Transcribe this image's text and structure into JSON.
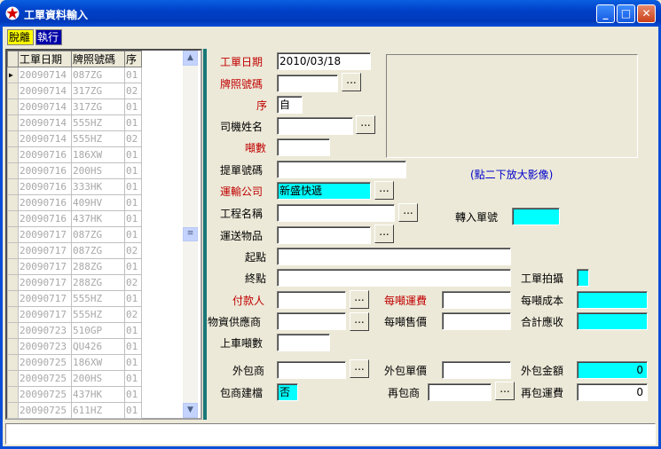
{
  "window": {
    "title": "工單資料輸入"
  },
  "toolbar": {
    "leave_label": "脫離",
    "run_label": "執行"
  },
  "grid": {
    "columns": [
      "工單日期",
      "牌照號碼",
      "序"
    ],
    "rows": [
      [
        "20090714",
        "087ZG",
        "01"
      ],
      [
        "20090714",
        "317ZG",
        "02"
      ],
      [
        "20090714",
        "317ZG",
        "01"
      ],
      [
        "20090714",
        "555HZ",
        "01"
      ],
      [
        "20090714",
        "555HZ",
        "02"
      ],
      [
        "20090716",
        "186XW",
        "01"
      ],
      [
        "20090716",
        "200HS",
        "01"
      ],
      [
        "20090716",
        "333HK",
        "01"
      ],
      [
        "20090716",
        "409HV",
        "01"
      ],
      [
        "20090716",
        "437HK",
        "01"
      ],
      [
        "20090717",
        "087ZG",
        "01"
      ],
      [
        "20090717",
        "087ZG",
        "02"
      ],
      [
        "20090717",
        "288ZG",
        "01"
      ],
      [
        "20090717",
        "288ZG",
        "02"
      ],
      [
        "20090717",
        "555HZ",
        "01"
      ],
      [
        "20090717",
        "555HZ",
        "02"
      ],
      [
        "20090723",
        "510GP",
        "01"
      ],
      [
        "20090723",
        "QU426",
        "01"
      ],
      [
        "20090725",
        "186XW",
        "01"
      ],
      [
        "20090725",
        "200HS",
        "01"
      ],
      [
        "20090725",
        "437HK",
        "01"
      ],
      [
        "20090725",
        "611HZ",
        "01"
      ]
    ]
  },
  "form": {
    "date": {
      "label": "工單日期",
      "value": "2010/03/18"
    },
    "plate": {
      "label": "牌照號碼",
      "value": ""
    },
    "seq": {
      "label": "序",
      "value": "自"
    },
    "driver": {
      "label": "司機姓名",
      "value": ""
    },
    "tons": {
      "label": "噸數",
      "value": ""
    },
    "bill": {
      "label": "提單號碼",
      "value": ""
    },
    "company": {
      "label": "運輸公司",
      "value": "新盛快遞"
    },
    "project": {
      "label": "工程名稱",
      "value": ""
    },
    "transfer": {
      "label": "轉入單號",
      "value": ""
    },
    "goods": {
      "label": "運送物品",
      "value": ""
    },
    "start": {
      "label": "起點",
      "value": ""
    },
    "end": {
      "label": "終點",
      "value": ""
    },
    "photo": {
      "label": "工單拍攝",
      "value": ""
    },
    "payer": {
      "label": "付款人",
      "value": ""
    },
    "freight_per_ton": {
      "label": "每噸運費",
      "value": ""
    },
    "cost_per_ton": {
      "label": "每噸成本",
      "value": ""
    },
    "supplier": {
      "label": "物資供應商",
      "value": ""
    },
    "price_per_ton": {
      "label": "每噸售價",
      "value": ""
    },
    "receivable": {
      "label": "合計應收",
      "value": ""
    },
    "load_tons": {
      "label": "上車噸數",
      "value": ""
    },
    "subcontractor": {
      "label": "外包商",
      "value": ""
    },
    "sub_price": {
      "label": "外包單價",
      "value": ""
    },
    "sub_amount": {
      "label": "外包金額",
      "value": "0"
    },
    "sub_file": {
      "label": "包商建檔",
      "value": "否"
    },
    "resub": {
      "label": "再包商",
      "value": ""
    },
    "resub_freight": {
      "label": "再包運費",
      "value": "0"
    },
    "image_note": "(點二下放大影像)",
    "dots_label": "..."
  },
  "status": {
    "text": ""
  }
}
